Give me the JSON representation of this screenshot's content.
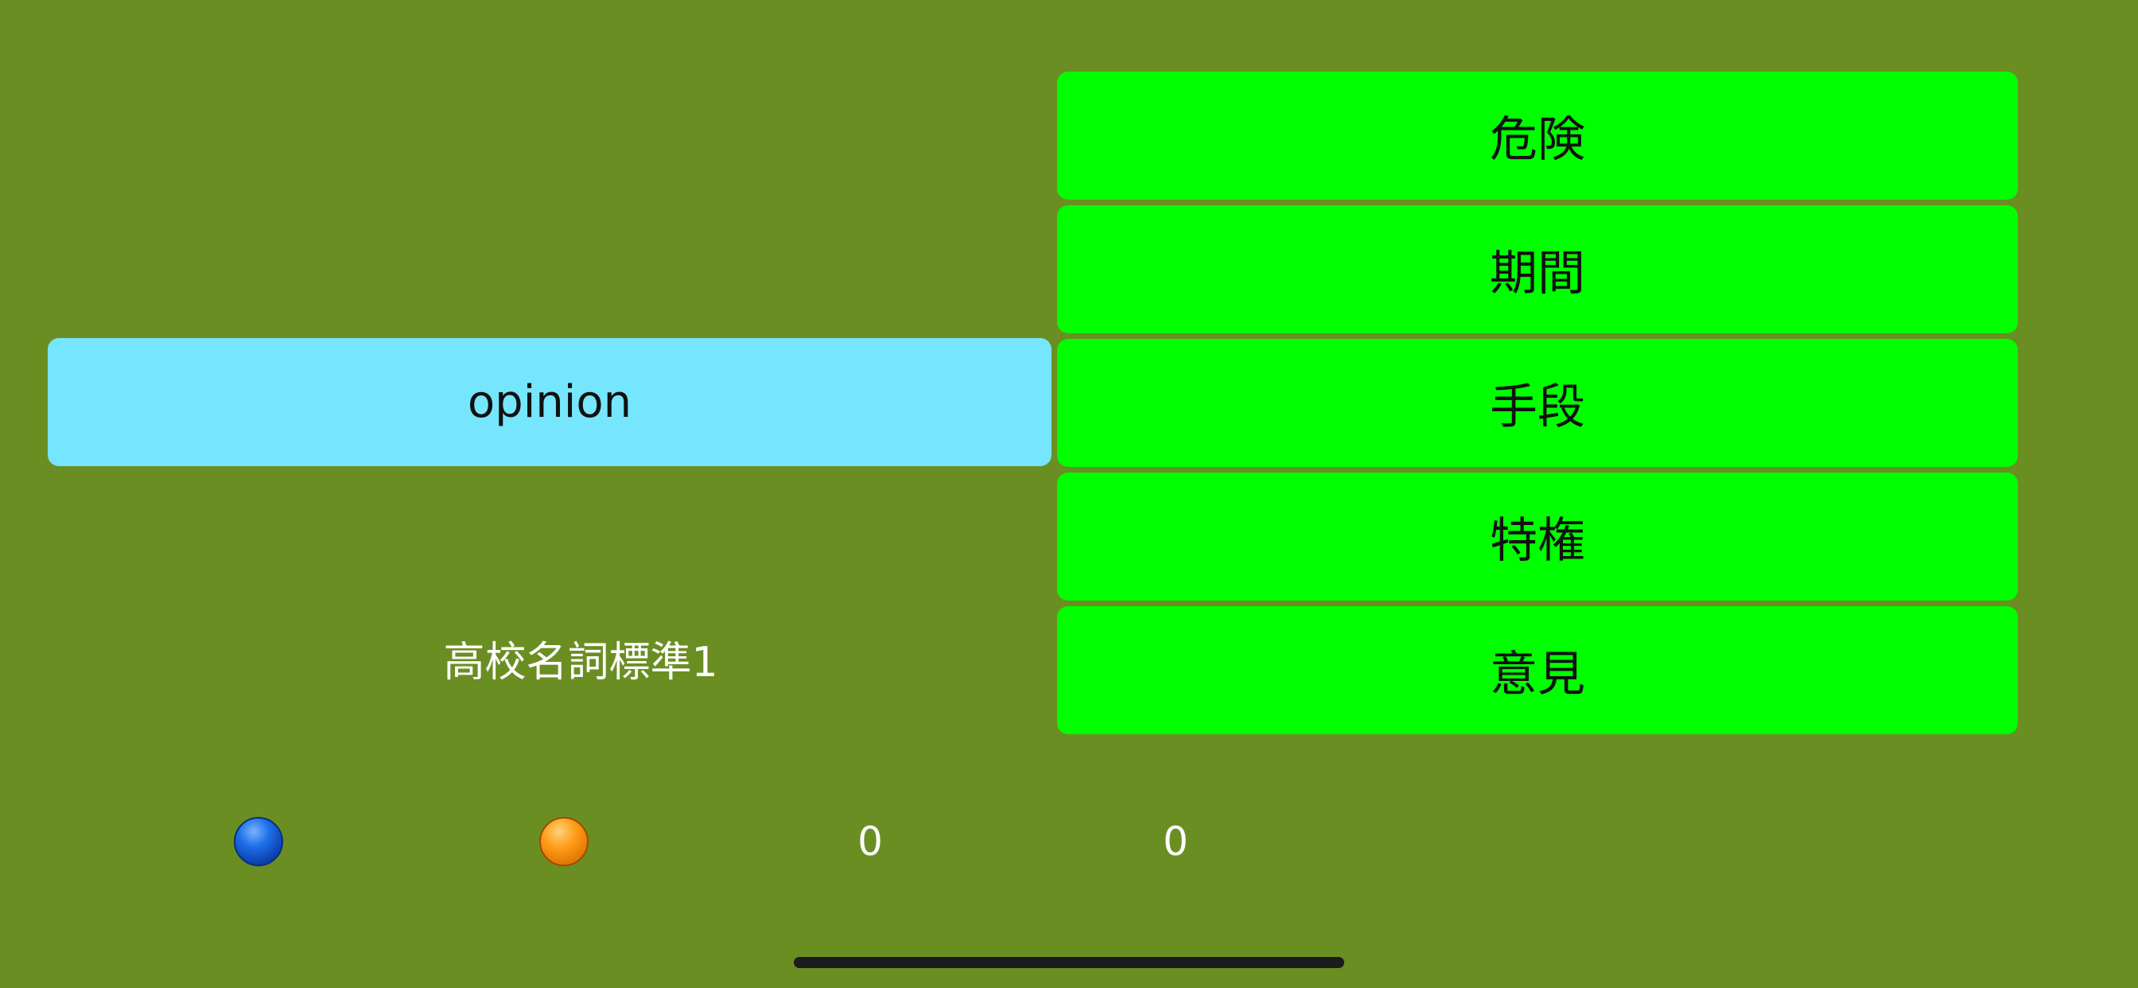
{
  "question": {
    "word": "opinion"
  },
  "choices": [
    {
      "label": "危険"
    },
    {
      "label": "期間"
    },
    {
      "label": "手段"
    },
    {
      "label": "特権"
    },
    {
      "label": "意見"
    }
  ],
  "deck": {
    "name": "高校名詞標準1"
  },
  "scores": {
    "blue": "0",
    "orange": "0"
  },
  "colors": {
    "background": "#6b8e23",
    "question_card": "#75e6fd",
    "choice_button": "#00ff00",
    "blue_ball": "#1f6fe8",
    "orange_ball": "#ff9c1a"
  }
}
